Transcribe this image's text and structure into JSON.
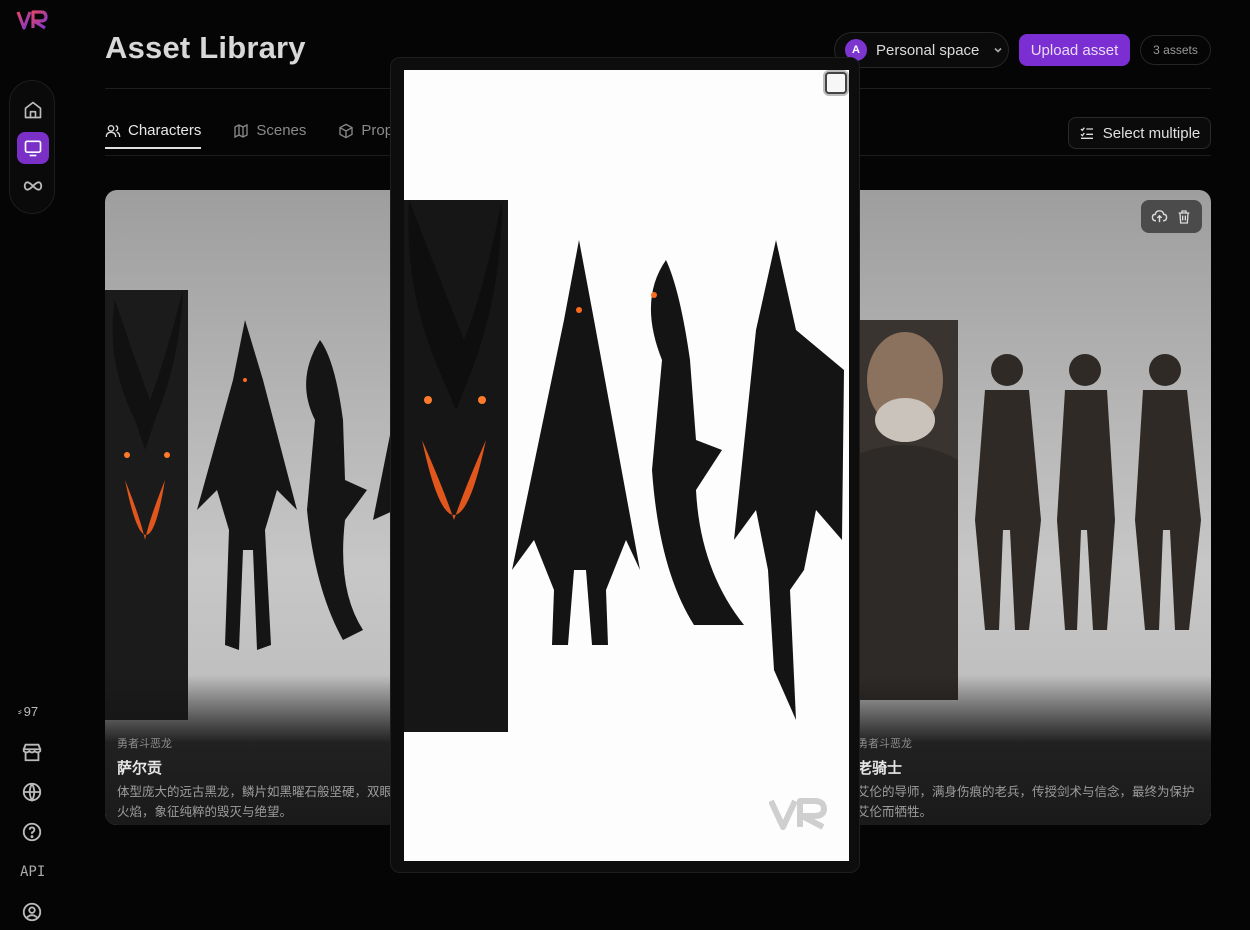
{
  "app": {
    "logo_text": "VR",
    "brand_colors": {
      "accent": "#7b2ed1",
      "purple": "#7d35d0",
      "pink": "#e0456a"
    }
  },
  "sidebar": {
    "nav": [
      {
        "icon": "home-icon"
      },
      {
        "icon": "monitor-icon",
        "active": true
      },
      {
        "icon": "infinity-icon"
      }
    ],
    "credits": "97",
    "bottom": [
      {
        "icon": "store-icon"
      },
      {
        "icon": "globe-icon"
      },
      {
        "icon": "help-icon"
      },
      {
        "icon": "api-icon",
        "label": "API"
      },
      {
        "icon": "user-icon"
      }
    ]
  },
  "header": {
    "title": "Asset Library",
    "space": {
      "avatar_letter": "A",
      "label": "Personal space"
    },
    "upload_label": "Upload asset",
    "asset_count": "3 assets"
  },
  "tabs": [
    {
      "label": "Characters",
      "icon": "users-icon",
      "active": true
    },
    {
      "label": "Scenes",
      "icon": "map-icon"
    },
    {
      "label": "Prop",
      "icon": "box-icon"
    }
  ],
  "select_multiple_label": "Select multiple",
  "cards": [
    {
      "tag": "勇者斗恶龙",
      "name": "萨尔贡",
      "desc": "体型庞大的远古黑龙，鳞片如黑曜石般坚硬，双眼燃",
      "desc2": "火焰，象征纯粹的毁灭与绝望。"
    },
    {
      "tag": "勇者斗恶龙",
      "name": "老骑士",
      "desc": "艾伦的导师，满身伤痕的老兵，传授剑术与信念，最终为保护",
      "desc2": "艾伦而牺牲。",
      "actions": [
        "upload-cloud-icon",
        "trash-icon"
      ]
    }
  ],
  "modal": {
    "watermark": "VR"
  }
}
